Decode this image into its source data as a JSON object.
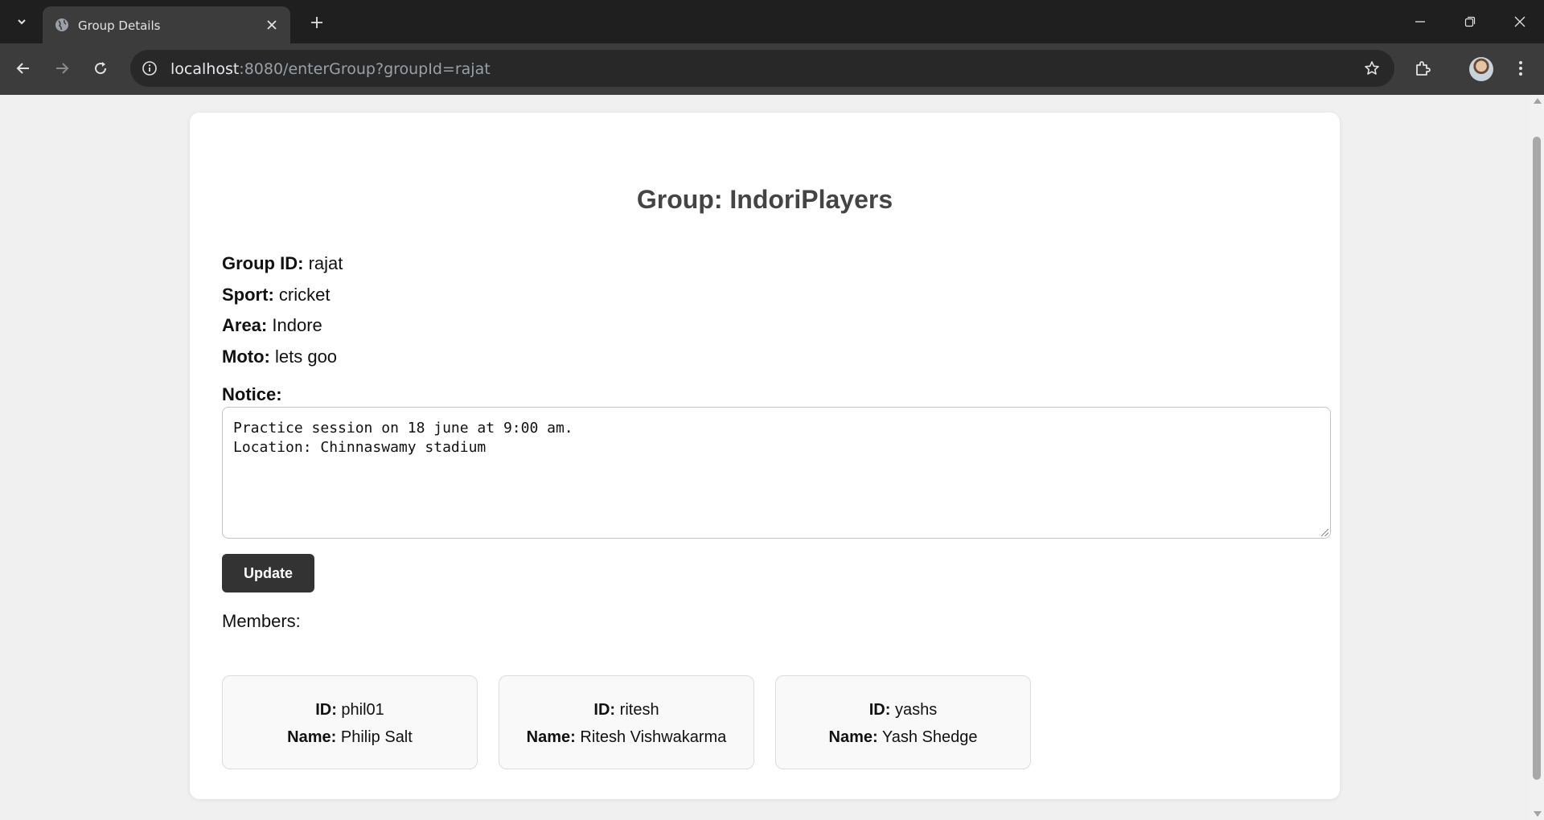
{
  "browser": {
    "tab_title": "Group Details",
    "url_host": "localhost",
    "url_rest": ":8080/enterGroup?groupId=rajat"
  },
  "page": {
    "group_title": "Group: IndoriPlayers",
    "group_id_label": "Group ID:",
    "group_id": "rajat",
    "sport_label": "Sport:",
    "sport": "cricket",
    "area_label": "Area:",
    "area": "Indore",
    "moto_label": "Moto:",
    "moto": "lets goo",
    "notice_label": "Notice:",
    "notice_text": "Practice session on 18 june at 9:00 am.\nLocation: Chinnaswamy stadium",
    "update_label": "Update",
    "members_label": "Members:",
    "id_label": "ID:",
    "name_label": "Name:",
    "members": [
      {
        "id": "phil01",
        "name": "Philip Salt"
      },
      {
        "id": "ritesh",
        "name": "Ritesh Vishwakarma"
      },
      {
        "id": "yashs",
        "name": "Yash Shedge"
      }
    ]
  },
  "colors": {
    "chrome_dark": "#1f1f1f",
    "toolbar": "#3c3c3c",
    "page_bg": "#f0f0f0",
    "button_bg": "#333333",
    "title_color": "#444444"
  }
}
